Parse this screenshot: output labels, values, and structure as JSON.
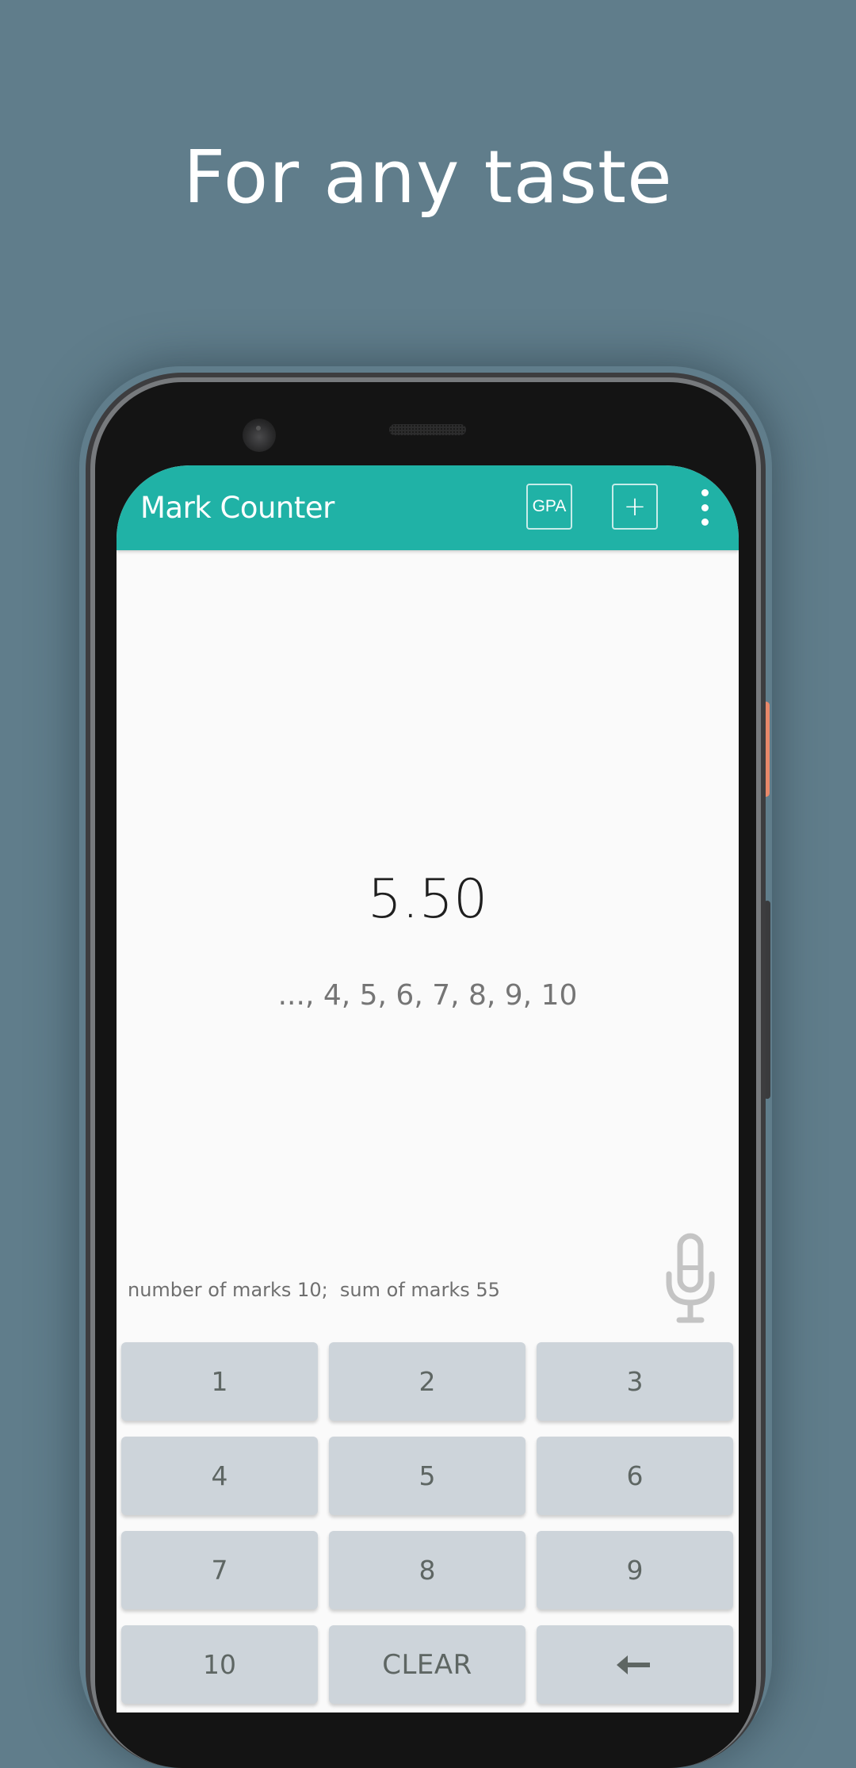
{
  "promo": {
    "headline": "For any taste"
  },
  "app": {
    "title": "Mark Counter",
    "accent_color": "#20b2a6",
    "toolbar": {
      "gpa_label": "GPA",
      "add_label": "+",
      "menu_icon": "more-vert-icon"
    }
  },
  "main": {
    "average": "5.50",
    "marks_list": "..., 4, 5, 6, 7, 8, 9, 10",
    "summary": "number of marks 10;  sum of marks 55",
    "mic_icon": "microphone-icon"
  },
  "keypad": {
    "keys": [
      {
        "label": "1"
      },
      {
        "label": "2"
      },
      {
        "label": "3"
      },
      {
        "label": "4"
      },
      {
        "label": "5"
      },
      {
        "label": "6"
      },
      {
        "label": "7"
      },
      {
        "label": "8"
      },
      {
        "label": "9"
      },
      {
        "label": "10"
      },
      {
        "label": "CLEAR"
      },
      {
        "label": "backspace",
        "icon": "left-arrow-icon"
      }
    ]
  }
}
